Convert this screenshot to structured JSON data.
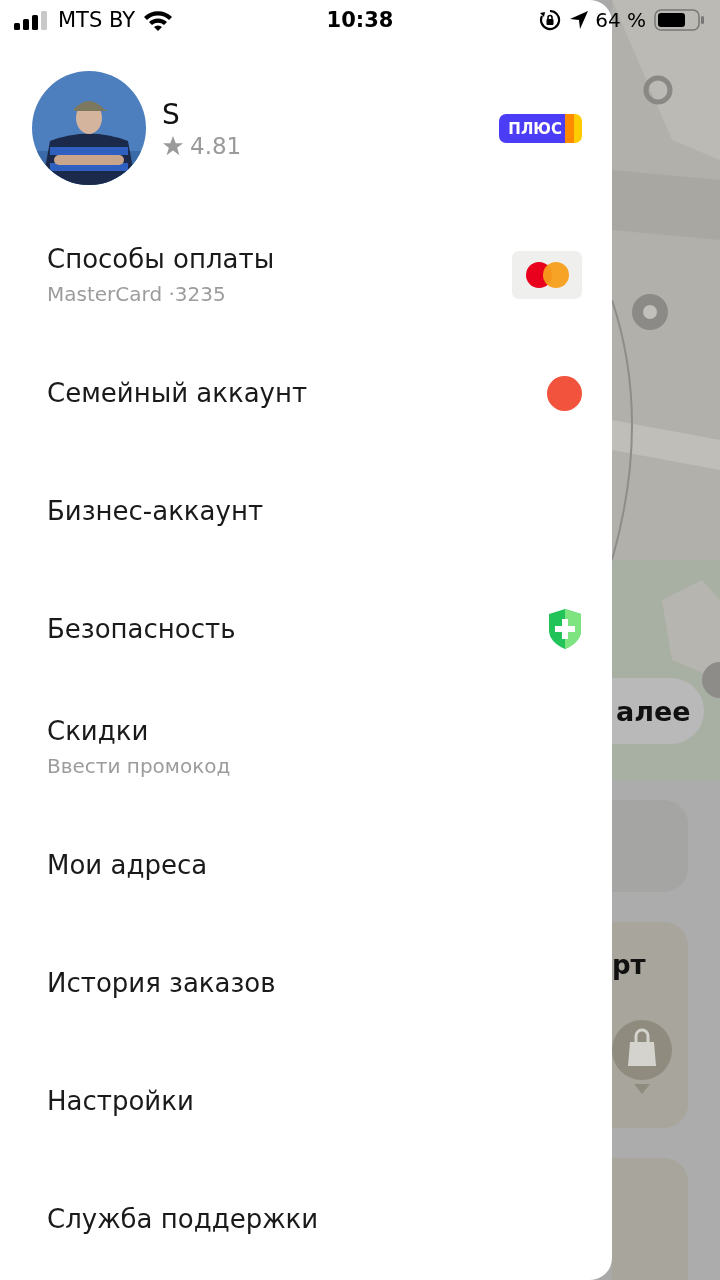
{
  "status_bar": {
    "carrier": "MTS BY",
    "time": "10:38",
    "battery_text": "64 %"
  },
  "profile": {
    "name": "S",
    "rating": "4.81",
    "badge": "ПЛЮС"
  },
  "menu": [
    {
      "title": "Способы оплаты",
      "subtitle": "MasterCard ·3235",
      "kind": "card"
    },
    {
      "title": "Семейный аккаунт",
      "kind": "dot",
      "color": "#f2533d"
    },
    {
      "title": "Бизнес-аккаунт",
      "kind": "plain"
    },
    {
      "title": "Безопасность",
      "kind": "shield"
    },
    {
      "title": "Скидки",
      "subtitle": "Ввести промокод",
      "kind": "plain"
    },
    {
      "title": "Мои адреса",
      "kind": "plain"
    },
    {
      "title": "История заказов",
      "kind": "plain"
    },
    {
      "title": "Настройки",
      "kind": "plain"
    },
    {
      "title": "Служба поддержки",
      "kind": "plain"
    }
  ],
  "background": {
    "button": "алее",
    "card_title": "рт"
  }
}
